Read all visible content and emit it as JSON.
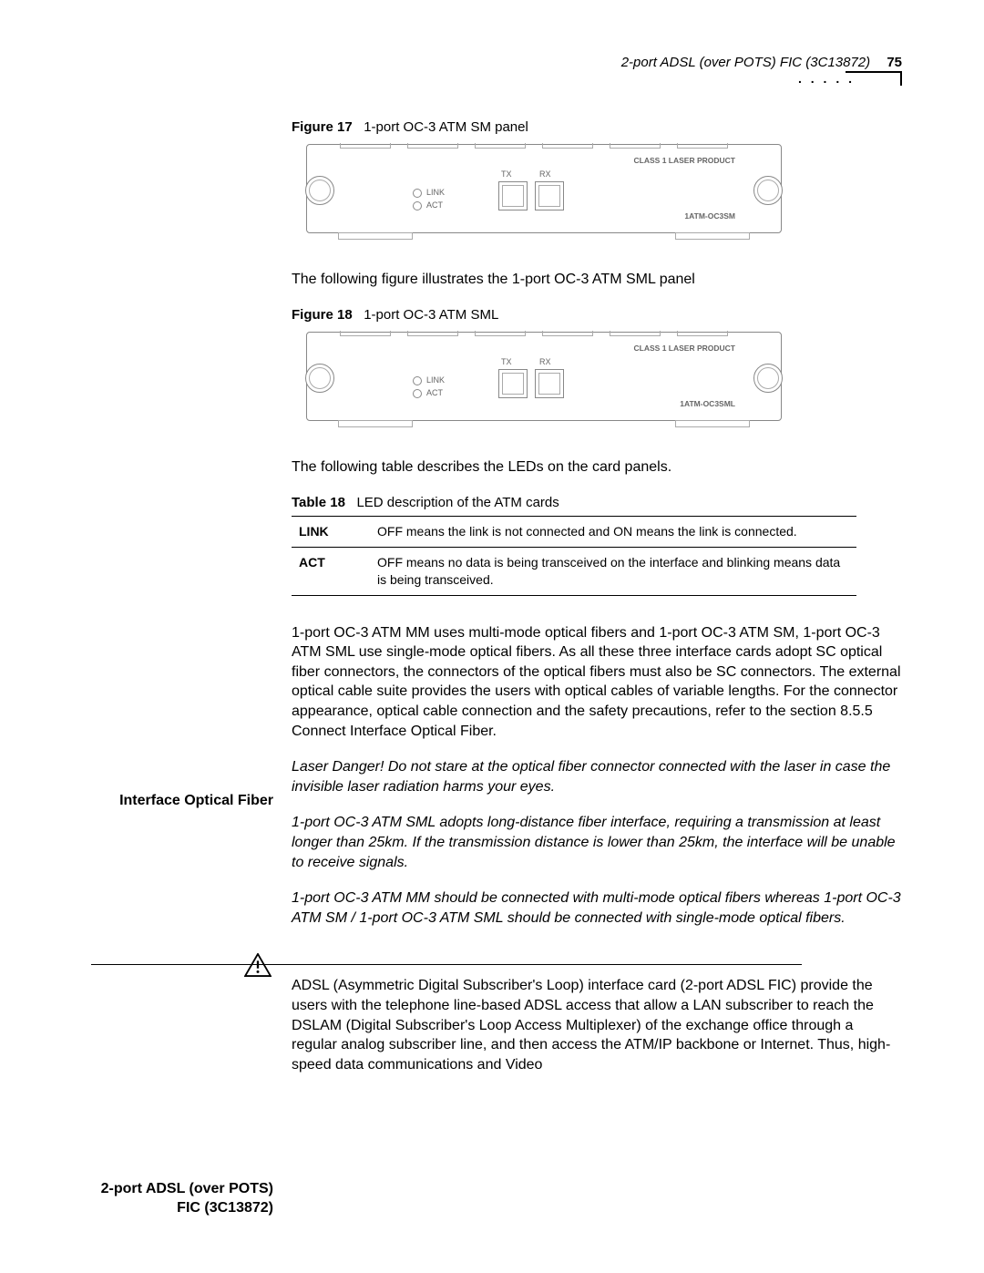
{
  "header": {
    "running_title": "2-port ADSL (over POTS) FIC (3C13872)",
    "page_number": "75"
  },
  "figure17": {
    "label": "Figure 17",
    "caption": "1-port OC-3 ATM SM panel",
    "panel_labels": {
      "tx": "TX",
      "rx": "RX",
      "link": "LINK",
      "act": "ACT",
      "laser": "CLASS 1 LASER PRODUCT",
      "model": "1ATM-OC3SM"
    }
  },
  "intro_para_18": "The following figure illustrates the 1-port OC-3 ATM SML panel",
  "figure18": {
    "label": "Figure 18",
    "caption": "1-port OC-3 ATM SML",
    "panel_labels": {
      "tx": "TX",
      "rx": "RX",
      "link": "LINK",
      "act": "ACT",
      "laser": "CLASS 1 LASER PRODUCT",
      "model": "1ATM-OC3SML"
    }
  },
  "intro_para_table": "The following table describes the LEDs on the card panels.",
  "table18": {
    "label": "Table 18",
    "caption": "LED description of the ATM cards",
    "rows": [
      {
        "name": "LINK",
        "desc": "OFF means the link is not connected and ON means the link is connected."
      },
      {
        "name": "ACT",
        "desc": "OFF means no data is being transceived on the interface and blinking means data is being transceived."
      }
    ]
  },
  "side_headings": {
    "optical_fiber": "Interface Optical Fiber",
    "adsl": "2-port ADSL (over POTS) FIC (3C13872)"
  },
  "optical_fiber_para": "1-port OC-3 ATM MM uses multi-mode optical fibers and 1-port OC-3 ATM SM, 1-port OC-3 ATM SML use single-mode optical fibers. As all these three interface cards adopt SC optical fiber connectors, the connectors of the optical fibers must also be SC connectors. The external optical cable suite provides the users with optical cables of variable lengths. For the connector appearance, optical cable connection and the safety precautions, refer to the section 8.5.5 Connect Interface Optical Fiber.",
  "warnings": {
    "laser": "Laser Danger! Do not stare at the optical fiber connector connected with the laser in case the invisible laser radiation harms your eyes.",
    "sml_distance": "1-port OC-3 ATM SML adopts long-distance fiber interface, requiring a transmission at least longer than 25km. If the transmission distance is lower than 25km, the interface will be unable to receive signals.",
    "fiber_type": "1-port OC-3 ATM MM should be connected with multi-mode optical fibers whereas 1-port OC-3 ATM SM / 1-port OC-3 ATM SML should be connected with single-mode optical fibers."
  },
  "adsl_para": "ADSL (Asymmetric Digital Subscriber's Loop) interface card (2-port ADSL FIC) provide the users with the telephone line-based ADSL access that allow a LAN subscriber to reach the DSLAM (Digital Subscriber's Loop Access Multiplexer) of the exchange office through a regular analog subscriber line, and then access the ATM/IP backbone or Internet. Thus, high-speed data communications and Video"
}
